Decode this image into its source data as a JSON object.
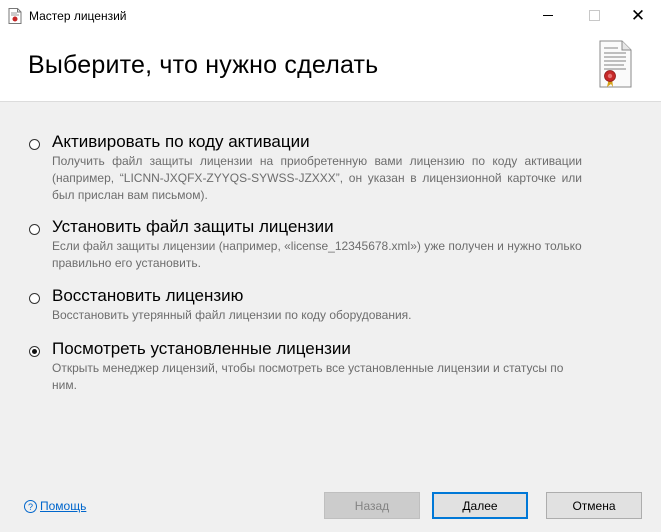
{
  "window": {
    "title": "Мастер лицензий",
    "controls": {
      "minimize_icon": "minimize-icon",
      "maximize_icon": "maximize-icon",
      "close_glyph": "✕"
    }
  },
  "header": {
    "title": "Выберите, что нужно сделать",
    "icon": "license-certificate-icon"
  },
  "options": [
    {
      "title": "Активировать по коду активации",
      "description": "Получить файл защиты лицензии на приобретенную вами лицензию по коду активации (например, “LICNN-JXQFX-ZYYQS-SYWSS-JZXXX”, он указан в лицензионной карточке или был прислан вам письмом).",
      "selected": false
    },
    {
      "title": "Установить файл защиты лицензии",
      "description": "Если файл защиты лицензии (например, «license_12345678.xml») уже получен и нужно только правильно его установить.",
      "selected": false
    },
    {
      "title": "Восстановить лицензию",
      "description": "Восстановить утерянный файл лицензии по коду оборудования.",
      "selected": false
    },
    {
      "title": "Посмотреть установленные лицензии",
      "description": "Открыть менеджер лицензий, чтобы посмотреть все установленные лицензии и статусы по ним.",
      "selected": true
    }
  ],
  "footer": {
    "help_glyph": "?",
    "help_label": "Помощь",
    "back_label": "Назад",
    "next_label": "Далее",
    "cancel_label": "Отмена"
  },
  "colors": {
    "background": "#f0f0f0",
    "header_bg": "#ffffff",
    "link": "#0066cc",
    "default_button_border": "#0078d7"
  }
}
